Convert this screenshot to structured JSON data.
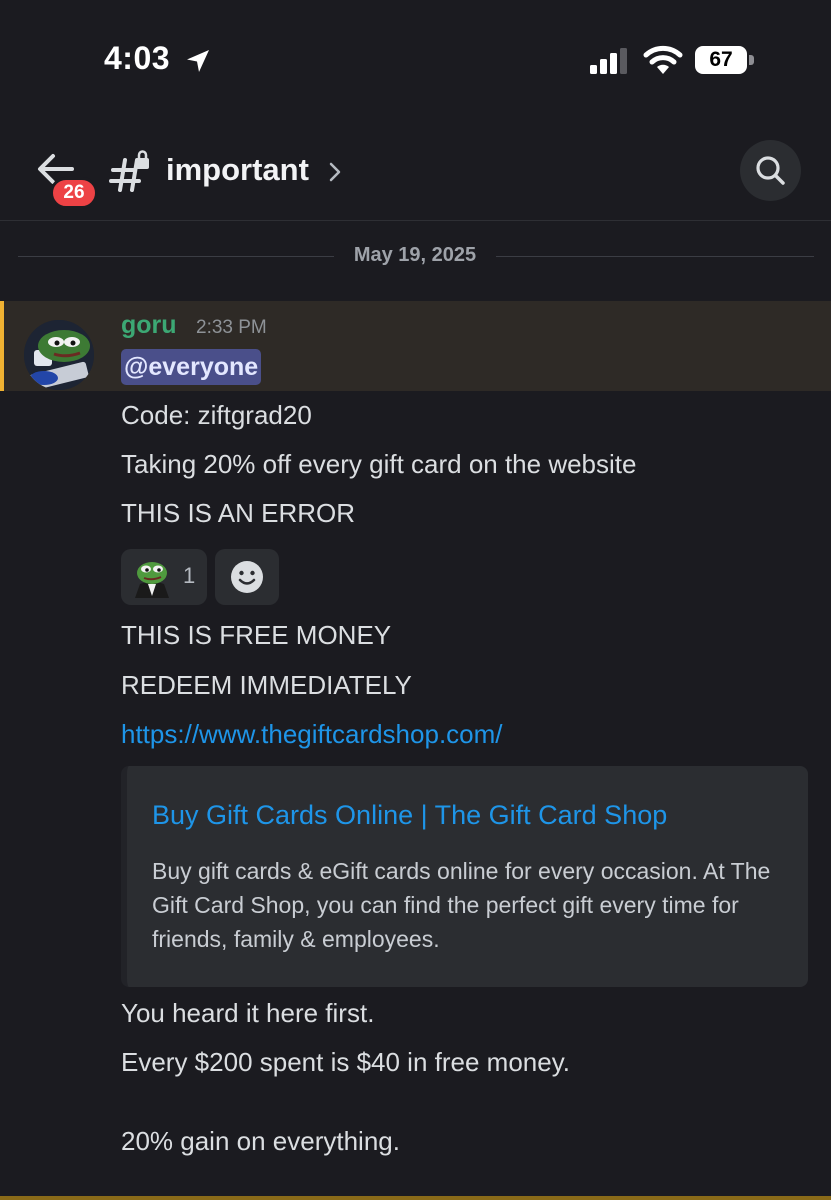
{
  "status_bar": {
    "time": "4:03",
    "battery": "67",
    "icons": [
      "location-arrow-icon",
      "cellular-signal-icon",
      "wifi-icon",
      "battery-icon"
    ]
  },
  "header": {
    "unread_badge": "26",
    "channel_name": "important",
    "icons": [
      "back-arrow-icon",
      "locked-hashtag-icon",
      "chevron-right-icon",
      "search-icon"
    ]
  },
  "date_divider": "May 19, 2025",
  "message": {
    "author": "goru",
    "timestamp": "2:33 PM",
    "mention": "@everyone",
    "lines_before_reactions": [
      "Code: ziftgrad20",
      "Taking 20% off every gift card on the website",
      "THIS IS AN ERROR"
    ],
    "reactions": [
      {
        "emoji": "pepe-suit-emoji",
        "count": "1"
      }
    ],
    "lines_after_reactions": [
      "THIS IS FREE MONEY",
      "REDEEM IMMEDIATELY"
    ],
    "link": "https://www.thegiftcardshop.com/",
    "embed": {
      "title": "Buy Gift Cards Online | The Gift Card Shop",
      "description": "Buy gift cards & eGift cards online for every occasion. At The Gift Card Shop, you can find the perfect gift every time for friends, family & employees."
    },
    "lines_after_embed": [
      "You heard it here first.",
      "Every $200 spent is $40 in free money.",
      "20% gain on everything."
    ]
  },
  "colors": {
    "background": "#1b1b20",
    "mention_highlight": "#2e2a26",
    "mention_bar": "#f0b232",
    "author": "#3ca874",
    "link": "#1e95e8",
    "badge": "#ed4245"
  }
}
